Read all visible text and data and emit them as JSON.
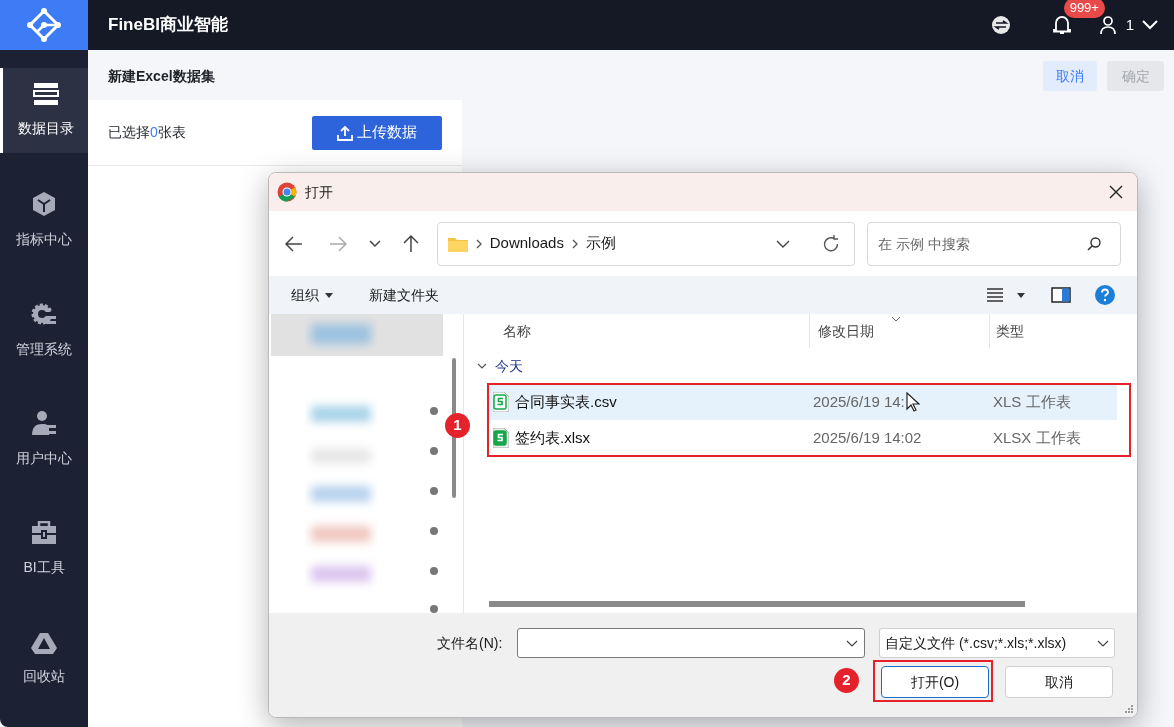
{
  "app": {
    "title": "FineBI商业智能",
    "notification_count": "999+",
    "user": "1"
  },
  "sidebar": {
    "items": [
      {
        "label": "数据目录",
        "selected": true
      },
      {
        "label": "指标中心",
        "selected": false
      },
      {
        "label": "管理系统",
        "selected": false
      },
      {
        "label": "用户中心",
        "selected": false
      },
      {
        "label": "BI工具",
        "selected": false
      },
      {
        "label": "回收站",
        "selected": false
      }
    ]
  },
  "page": {
    "title": "新建Excel数据集",
    "cancel": "取消",
    "confirm": "确定",
    "confirm_disabled": true,
    "selection": {
      "prefix": "已选择",
      "count": "0",
      "suffix": "张表"
    },
    "upload": "上传数据"
  },
  "dialog": {
    "title": "打开",
    "path": [
      "Downloads",
      "示例"
    ],
    "search_placeholder": "在 示例 中搜索",
    "toolbar": {
      "organize": "组织",
      "new_folder": "新建文件夹"
    },
    "columns": [
      "名称",
      "修改日期",
      "类型"
    ],
    "group": "今天",
    "files": [
      {
        "name": "合同事实表.csv",
        "date": "2025/6/19 14:",
        "type": "XLS 工作表",
        "selected": true
      },
      {
        "name": "签约表.xlsx",
        "date": "2025/6/19 14:02",
        "type": "XLSX 工作表",
        "selected": false
      }
    ],
    "filename_label": "文件名(N):",
    "filter": "自定义文件 (*.csv;*.xls;*.xlsx)",
    "open": "打开(O)",
    "cancel": "取消"
  },
  "annotations": [
    "1",
    "2"
  ]
}
